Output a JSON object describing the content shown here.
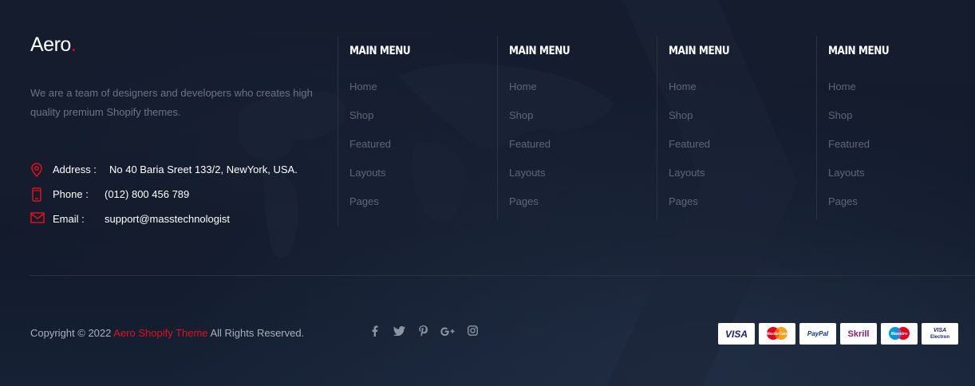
{
  "brand": {
    "logo_text": "Aero",
    "logo_dot": ".",
    "accent_color": "#e3101b"
  },
  "about": {
    "text": "We are a team of designers and developers who creates high quality premium Shopify themes."
  },
  "contact": {
    "address_label": "Address :",
    "address_value": "No 40 Baria Sreet 133/2, NewYork, USA.",
    "phone_label": "Phone :",
    "phone_value": "(012) 800 456 789",
    "email_label": "Email :",
    "email_value": "support@masstechnologist"
  },
  "menus": [
    {
      "title": "MAIN MENU",
      "items": [
        "Home",
        "Shop",
        "Featured",
        "Layouts",
        "Pages"
      ]
    },
    {
      "title": "MAIN MENU",
      "items": [
        "Home",
        "Shop",
        "Featured",
        "Layouts",
        "Pages"
      ]
    },
    {
      "title": "MAIN MENU",
      "items": [
        "Home",
        "Shop",
        "Featured",
        "Layouts",
        "Pages"
      ]
    },
    {
      "title": "MAIN MENU",
      "items": [
        "Home",
        "Shop",
        "Featured",
        "Layouts",
        "Pages"
      ]
    }
  ],
  "footer": {
    "copyright_prefix": "Copyright © 2022 ",
    "copyright_brand": "Aero Shopify Theme",
    "copyright_suffix": " All Rights Reserved."
  },
  "social": {
    "facebook": "f",
    "twitter": "t",
    "pinterest": "p",
    "google_plus": "G+",
    "instagram": "instagram"
  },
  "payments": {
    "visa": "VISA",
    "mastercard": "MasterCard",
    "paypal": "PayPal",
    "skrill": "Skrill",
    "maestro": "Maestro",
    "visa_electron_top": "VISA",
    "visa_electron_bottom": "Electron"
  },
  "colors": {
    "background": "#121a2b",
    "accent": "#e3101b",
    "muted_text": "#5f6676"
  }
}
